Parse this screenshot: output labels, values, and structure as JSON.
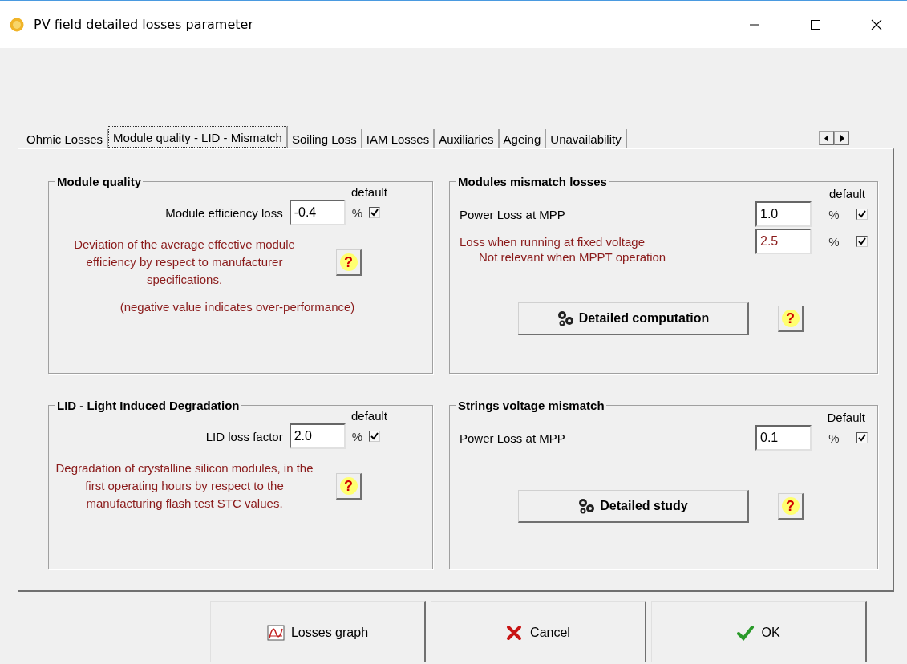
{
  "window": {
    "title": "PV field detailed losses parameter"
  },
  "tabs": [
    {
      "label": "Ohmic Losses",
      "selected": false
    },
    {
      "label": "Module quality - LID - Mismatch",
      "selected": true
    },
    {
      "label": "Soiling Loss",
      "selected": false
    },
    {
      "label": "IAM Losses",
      "selected": false
    },
    {
      "label": "Auxiliaries",
      "selected": false
    },
    {
      "label": "Ageing",
      "selected": false
    },
    {
      "label": "Unavailability",
      "selected": false
    }
  ],
  "groups": [
    {
      "kind": "compact",
      "title": "Module quality",
      "default_label": "default",
      "fields": [
        {
          "label": "Module efficiency loss",
          "value": "-0.4",
          "unit": "%",
          "checked": true,
          "warning": false
        }
      ],
      "description": "Deviation of the average effective module efficiency by respect to manufacturer specifications.",
      "note": "(negative value indicates over-performance)",
      "help": "?"
    },
    {
      "kind": "wide",
      "title": "Modules mismatch losses",
      "default_label": "default",
      "fields": [
        {
          "label": "Power Loss at MPP",
          "value": "1.0",
          "unit": "%",
          "checked": true,
          "warning": false
        },
        {
          "label": "Loss when running at fixed voltage",
          "value": "2.5",
          "unit": "%",
          "checked": true,
          "warning": true,
          "note": "Not relevant when MPPT operation"
        }
      ],
      "action": "Detailed computation",
      "help": "?"
    },
    {
      "kind": "compact",
      "title": "LID - Light Induced Degradation",
      "default_label": "default",
      "fields": [
        {
          "label": "LID loss factor",
          "value": "2.0",
          "unit": "%",
          "checked": true,
          "warning": false
        }
      ],
      "description": "Degradation of crystalline silicon modules, in the first operating hours by respect to the manufacturing flash test STC values.",
      "help": "?"
    },
    {
      "kind": "wide",
      "title": "Strings voltage mismatch",
      "default_label": "Default",
      "fields": [
        {
          "label": "Power Loss at MPP",
          "value": "0.1",
          "unit": "%",
          "checked": true,
          "warning": false
        }
      ],
      "action": "Detailed study",
      "help": "?"
    }
  ],
  "buttons": [
    {
      "kind": "graph",
      "label": "Losses graph"
    },
    {
      "kind": "cancel",
      "label": "Cancel"
    },
    {
      "kind": "ok",
      "label": "OK"
    }
  ]
}
